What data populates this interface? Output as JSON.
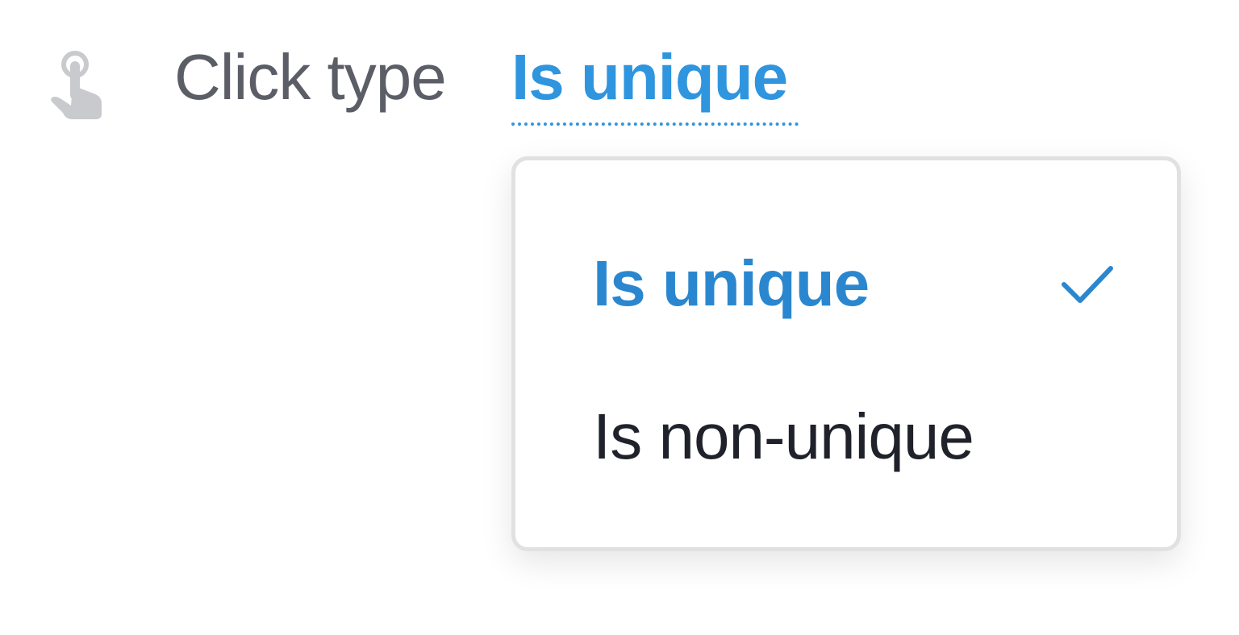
{
  "filter": {
    "icon": "pointer-hand-icon",
    "label": "Click type",
    "value": "Is unique"
  },
  "dropdown": {
    "options": [
      {
        "label": "Is unique",
        "selected": true
      },
      {
        "label": "Is non-unique",
        "selected": false
      }
    ],
    "selected_icon": "checkmark-icon"
  },
  "colors": {
    "accent": "#2f95de",
    "selected_option": "#2a87cf",
    "label_text": "#5b5e66",
    "option_text": "#1f222a",
    "icon_gray": "#c9cacd",
    "dropdown_border": "#e1e1e1"
  }
}
